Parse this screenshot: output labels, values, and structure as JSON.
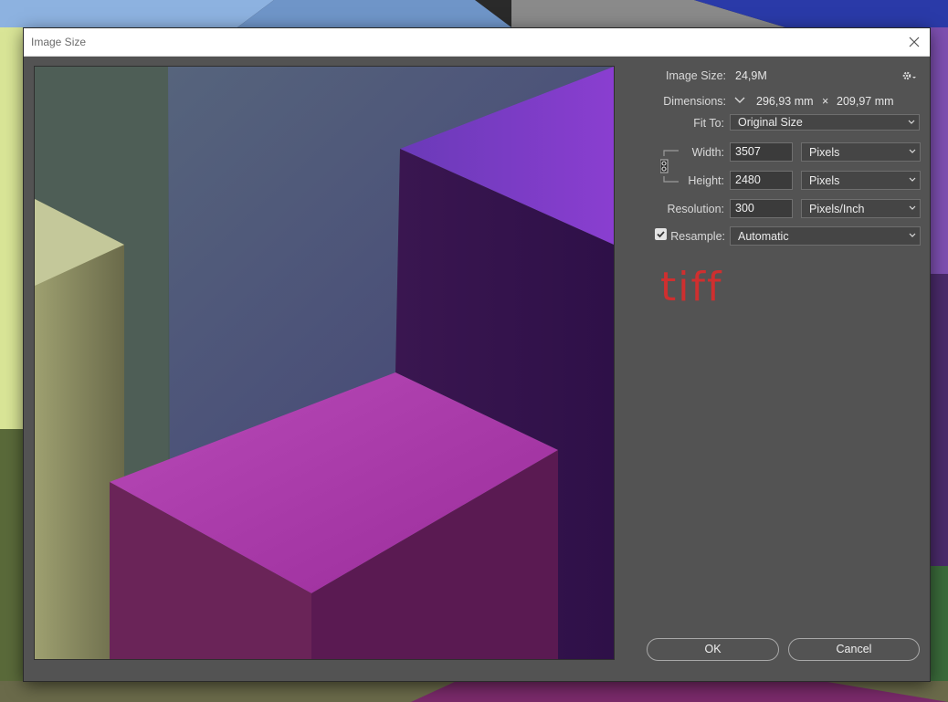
{
  "dialog": {
    "title": "Image Size",
    "close_icon": "close-icon"
  },
  "info": {
    "image_size_label": "Image Size:",
    "image_size_value": "24,9M",
    "gear_icon": "gear-icon",
    "dimensions_label": "Dimensions:",
    "dimensions_width": "296,93 mm",
    "dimensions_sep": "×",
    "dimensions_height": "209,97 mm"
  },
  "fit_to": {
    "label": "Fit To:",
    "value": "Original Size"
  },
  "width": {
    "label": "Width:",
    "value": "3507",
    "unit": "Pixels"
  },
  "height": {
    "label": "Height:",
    "value": "2480",
    "unit": "Pixels"
  },
  "resolution": {
    "label": "Resolution:",
    "value": "300",
    "unit": "Pixels/Inch"
  },
  "resample": {
    "label": "Resample:",
    "checked": true,
    "value": "Automatic"
  },
  "annotation": {
    "text": "tiff",
    "color": "#cf2f2f"
  },
  "buttons": {
    "ok": "OK",
    "cancel": "Cancel"
  },
  "colors": {
    "dialog_bg": "#535353",
    "field_bg": "#3b3b3b"
  }
}
